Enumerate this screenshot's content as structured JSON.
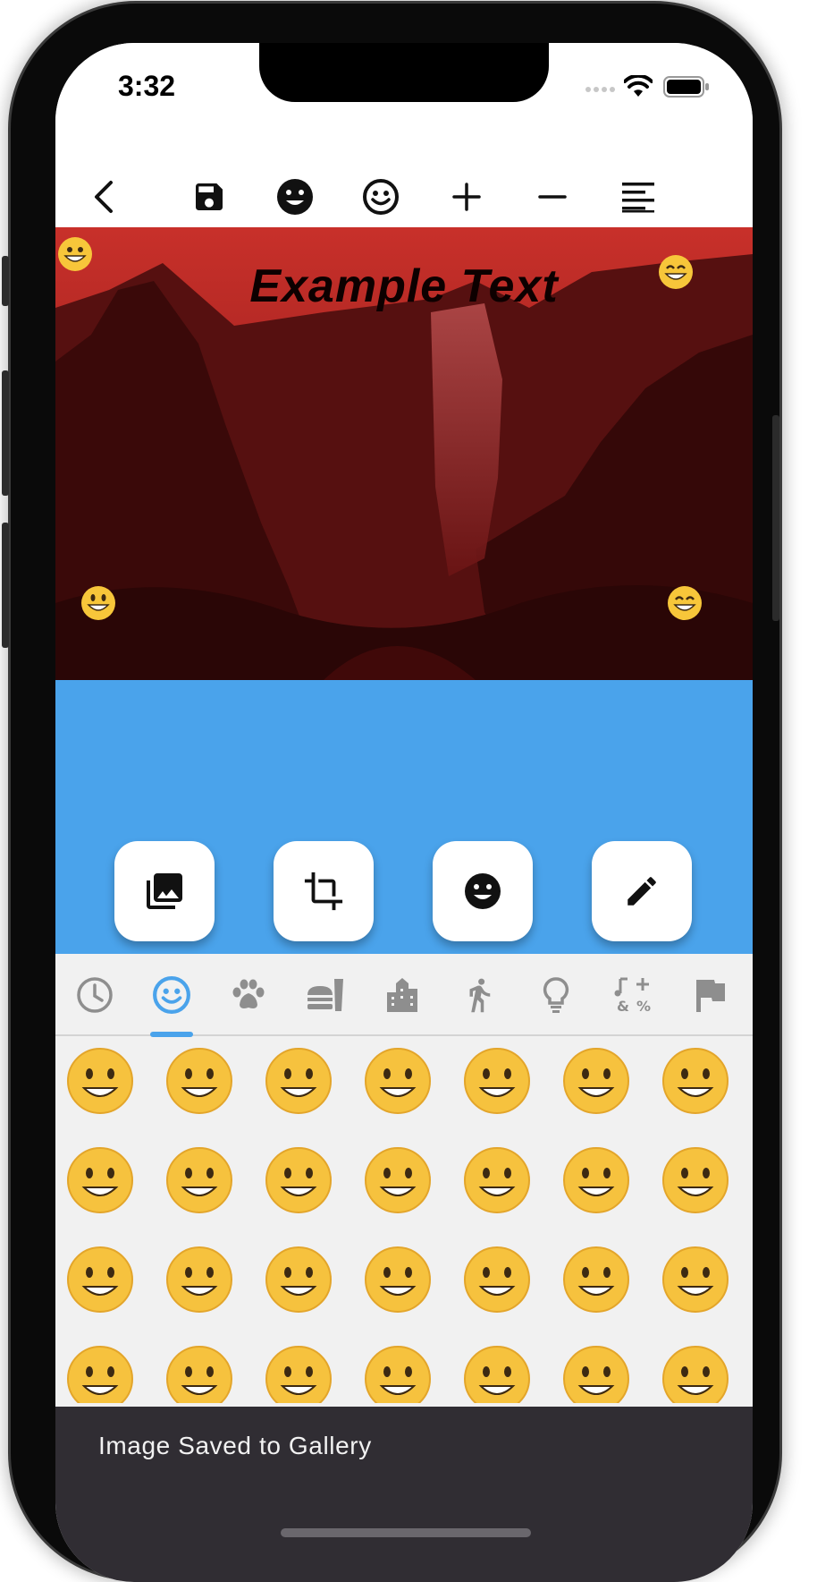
{
  "status_bar": {
    "time": "3:32"
  },
  "toolbar": {
    "icons": [
      "back-icon",
      "save-icon",
      "emoji-filled-icon",
      "emoji-outline-icon",
      "add-icon",
      "remove-icon",
      "align-icon"
    ]
  },
  "canvas": {
    "overlay_text": "Example Text",
    "tint_color": "#5a0e0e"
  },
  "actions": {
    "icons": [
      "gallery-icon",
      "crop-icon",
      "emoji-icon",
      "edit-icon"
    ],
    "background_color": "#4aa3eb"
  },
  "emoji_picker": {
    "categories": [
      "recent-icon",
      "smileys-icon",
      "animals-icon",
      "food-icon",
      "travel-icon",
      "activities-icon",
      "objects-icon",
      "symbols-icon",
      "flags-icon"
    ],
    "selected_category": "smileys-icon",
    "accent_color": "#4aa3eb",
    "emojis": [
      "😀",
      "😃",
      "😄",
      "😁",
      "😆",
      "😅",
      "🤣",
      "😂",
      "🙂",
      "🙃",
      "😉",
      "😊",
      "😇",
      "🥰",
      "😍",
      "🤩",
      "😘",
      "😗",
      "☺️",
      "😚",
      "😙",
      "😋",
      "😛",
      "😜",
      "🤪",
      "😝",
      "🤑",
      "🤗"
    ]
  },
  "snackbar": {
    "message": "Image Saved to Gallery"
  }
}
